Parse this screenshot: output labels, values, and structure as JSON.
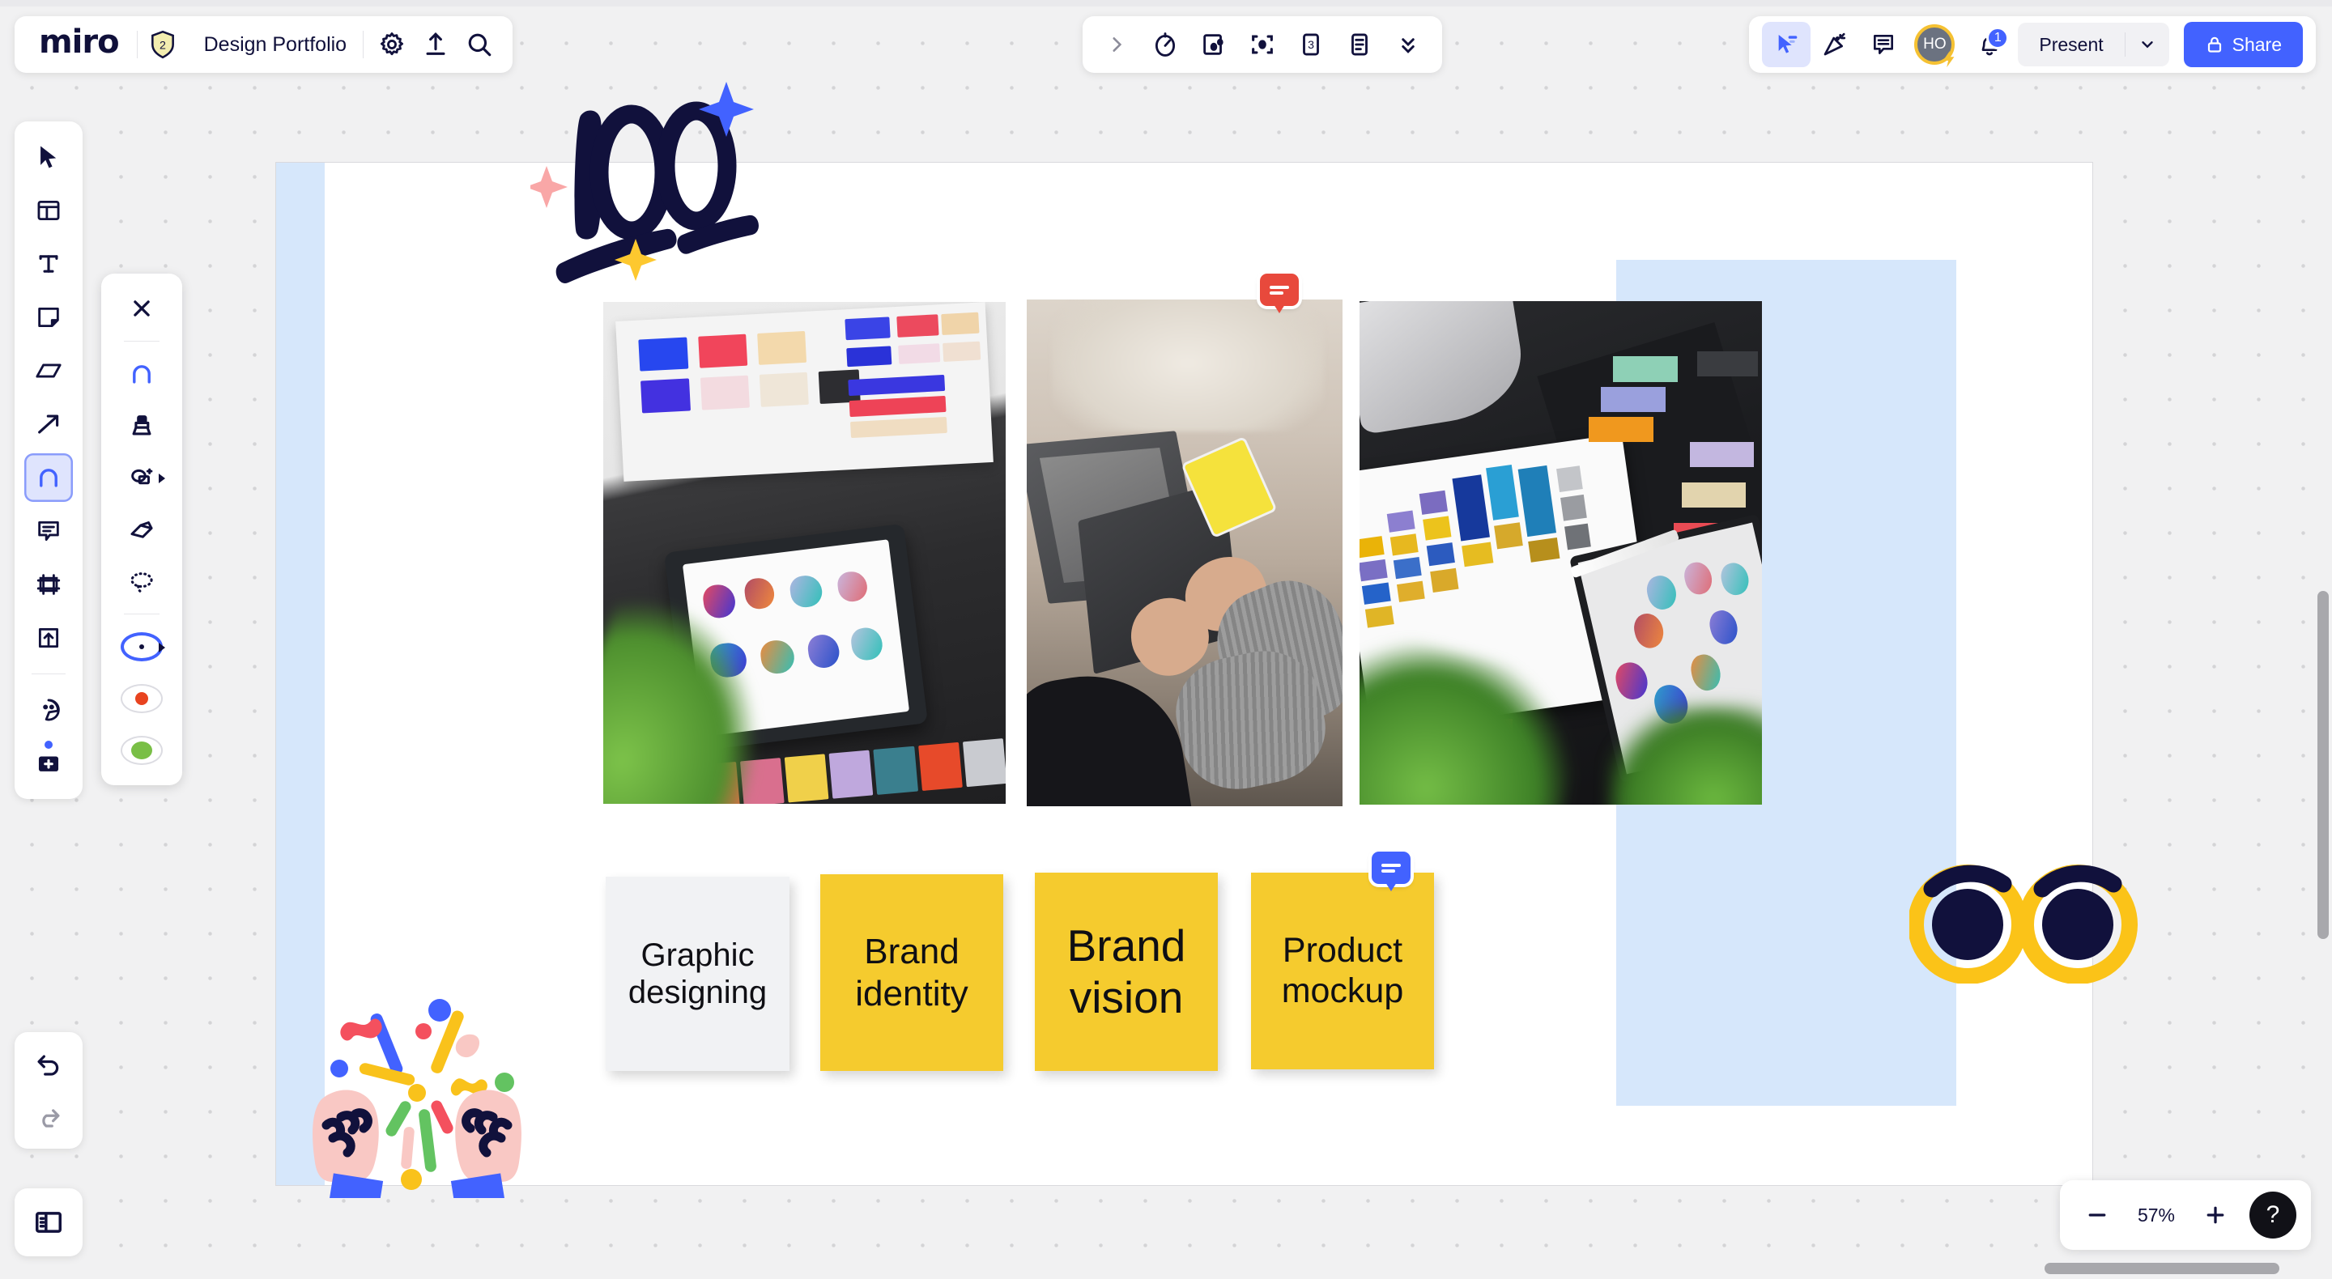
{
  "app": {
    "name": "miro",
    "board_title": "Design Portfolio",
    "members_badge": "2"
  },
  "header": {
    "left_icons": [
      {
        "name": "logo",
        "label": "miro"
      },
      {
        "name": "members-shield-icon",
        "label": "2"
      },
      {
        "name": "settings-gear-icon",
        "label": "Settings"
      },
      {
        "name": "export-upload-icon",
        "label": "Export"
      },
      {
        "name": "search-icon",
        "label": "Search"
      }
    ],
    "center_tools": [
      {
        "name": "expand-chevron-icon",
        "label": "Expand"
      },
      {
        "name": "timer-icon",
        "label": "Timer"
      },
      {
        "name": "voting-icon",
        "label": "Voting"
      },
      {
        "name": "focus-mode-icon",
        "label": "Attention management"
      },
      {
        "name": "cards-icon",
        "label": "Cards"
      },
      {
        "name": "notes-icon",
        "label": "Notes"
      },
      {
        "name": "more-chevrons-icon",
        "label": "More apps"
      }
    ],
    "right_tools": [
      {
        "name": "cursor-select-icon",
        "label": "Selection",
        "active": true
      },
      {
        "name": "celebrate-icon",
        "label": "Reactions"
      },
      {
        "name": "comment-list-icon",
        "label": "Comments"
      }
    ],
    "avatar": {
      "initials": "HO",
      "status": "online"
    },
    "notifications": {
      "count": "1"
    },
    "present_label": "Present",
    "share_label": "Share"
  },
  "left_toolbar": {
    "items": [
      {
        "name": "cursor-tool",
        "label": "Select"
      },
      {
        "name": "templates-tool",
        "label": "Templates"
      },
      {
        "name": "text-tool",
        "label": "Text"
      },
      {
        "name": "sticky-note-tool",
        "label": "Sticky note"
      },
      {
        "name": "shapes-tool",
        "label": "Shapes"
      },
      {
        "name": "connection-line-tool",
        "label": "Connection line"
      },
      {
        "name": "pen-tool",
        "label": "Pen",
        "active": true
      },
      {
        "name": "comment-tool",
        "label": "Comment"
      },
      {
        "name": "frame-tool",
        "label": "Frame"
      },
      {
        "name": "upload-tool",
        "label": "Upload"
      },
      {
        "name": "sticker-tool",
        "label": "Stickers"
      },
      {
        "name": "more-apps-tool",
        "label": "More apps"
      }
    ],
    "history": [
      {
        "name": "undo-button",
        "label": "Undo",
        "enabled": true
      },
      {
        "name": "redo-button",
        "label": "Redo",
        "enabled": false
      }
    ],
    "panel_toggle": {
      "name": "panel-toggle-button",
      "label": "Toggle panel"
    }
  },
  "pen_flyout": {
    "close_label": "Close",
    "tools": [
      {
        "name": "pen-option",
        "label": "Pen",
        "selected": true
      },
      {
        "name": "marker-option",
        "label": "Marker"
      },
      {
        "name": "smart-drawing-option",
        "label": "Smart drawing",
        "has_submenu": true
      },
      {
        "name": "eraser-option",
        "label": "Eraser"
      },
      {
        "name": "lasso-select-option",
        "label": "Lasso select"
      }
    ],
    "colors": [
      {
        "name": "color-swatch-current",
        "hex": "#10103a",
        "selected": true
      },
      {
        "name": "color-swatch-red",
        "hex": "#e8431f",
        "selected": false
      },
      {
        "name": "color-swatch-green",
        "hex": "#79bf46",
        "selected": false
      }
    ]
  },
  "canvas": {
    "frame": {
      "name": "board-frame",
      "background": "#ffffff"
    },
    "accent_blocks": [
      {
        "name": "blue-block-left",
        "hex": "#d6e7fb"
      },
      {
        "name": "blue-block-right",
        "hex": "#d6e7fb"
      }
    ],
    "doodle": {
      "name": "hundred-points-doodle",
      "label": "100"
    },
    "photos": [
      {
        "name": "photo-color-guide-desk",
        "alt": "Desk with color guide sheets and tablet"
      },
      {
        "name": "photo-laptop-lap",
        "alt": "Person typing on laptop on fur blanket"
      },
      {
        "name": "photo-pantone-swatches",
        "alt": "Pantone color swatch books on dark desk"
      }
    ],
    "comment_pins": [
      {
        "name": "comment-pin-red",
        "hex": "#e8493c",
        "target": "photo-laptop-lap"
      },
      {
        "name": "comment-pin-blue",
        "hex": "#4262ff",
        "target": "sticky-product-mockup"
      }
    ],
    "sticky_notes": [
      {
        "name": "sticky-graphic-designing",
        "text": "Graphic designing",
        "hex": "#f1f2f4",
        "text_color": "#1a1a1f"
      },
      {
        "name": "sticky-brand-identity",
        "text": "Brand identity",
        "hex": "#f5cb2e",
        "text_color": "#14141a"
      },
      {
        "name": "sticky-brand-vision",
        "text": "Brand vision",
        "hex": "#f5cb2e",
        "text_color": "#14141a"
      },
      {
        "name": "sticky-product-mockup",
        "text": "Product mockup",
        "hex": "#f5cb2e",
        "text_color": "#14141a"
      }
    ],
    "stickers": [
      {
        "name": "celebration-hands-sticker",
        "alt": "Raised fists with confetti"
      },
      {
        "name": "eyes-sticker",
        "alt": "Pair of looking eyes"
      }
    ]
  },
  "zoom_controls": {
    "zoom_out_label": "−",
    "level": "57%",
    "zoom_in_label": "+",
    "help_label": "?"
  }
}
